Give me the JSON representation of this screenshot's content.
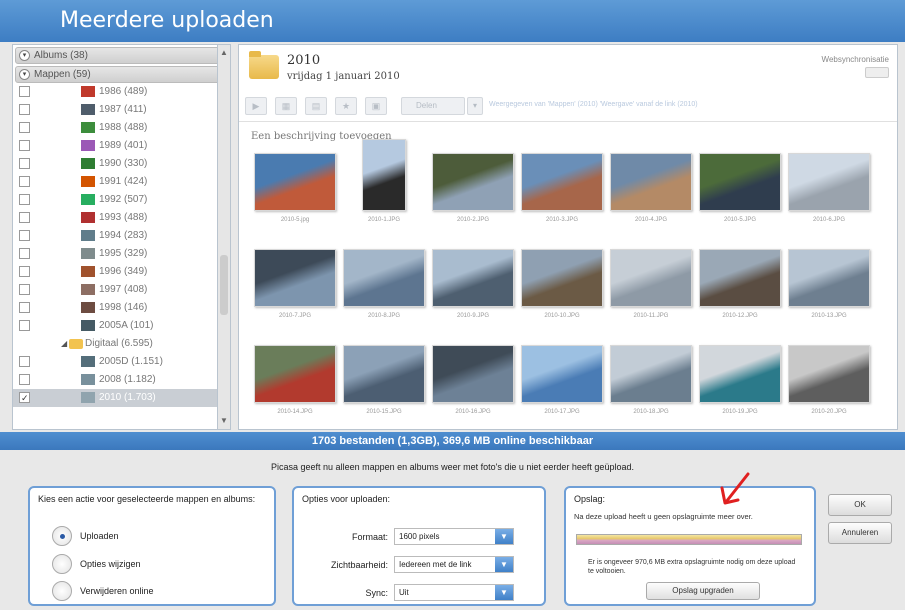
{
  "window": {
    "title": "Meerdere uploaden"
  },
  "sidebar": {
    "albums_header": "Albums (38)",
    "folders_header": "Mappen (59)",
    "items": [
      {
        "label": "1986 (489)",
        "color": "#c0392b"
      },
      {
        "label": "1987 (411)",
        "color": "#4f5d6b"
      },
      {
        "label": "1988 (488)",
        "color": "#3c8d3c"
      },
      {
        "label": "1989 (401)",
        "color": "#9b59b6"
      },
      {
        "label": "1990 (330)",
        "color": "#2e7d32"
      },
      {
        "label": "1991 (424)",
        "color": "#d35400"
      },
      {
        "label": "1992 (507)",
        "color": "#27ae60"
      },
      {
        "label": "1993 (488)",
        "color": "#b03030"
      },
      {
        "label": "1994 (283)",
        "color": "#607d8b"
      },
      {
        "label": "1995 (329)",
        "color": "#7f8c8d"
      },
      {
        "label": "1996 (349)",
        "color": "#a0522d"
      },
      {
        "label": "1997 (408)",
        "color": "#8d6e63"
      },
      {
        "label": "1998 (146)",
        "color": "#6d4c41"
      },
      {
        "label": "2005A (101)",
        "color": "#455a64"
      }
    ],
    "digital_folder": "Digitaal (6.595)",
    "digital_items": [
      {
        "label": "2005D (1.151)",
        "color": "#546e7a"
      },
      {
        "label": "2008 (1.182)",
        "color": "#78909c"
      },
      {
        "label": "2010 (1.703)",
        "color": "#90a4ae"
      }
    ]
  },
  "album": {
    "title": "2010",
    "date": "vrijdag 1 januari 2010",
    "websync_label": "Websynchronisatie",
    "share_label": "Delen",
    "toolbar_info": "Weergegeven van 'Mappen' (2010) 'Weergave' vanaf de link (2010)",
    "description_placeholder": "Een beschrijving toevoegen",
    "photos": [
      {
        "caption": "2010-5.jpg",
        "colors": [
          "#c05a3a",
          "#4a7bb0"
        ]
      },
      {
        "caption": "2010-1.JPG",
        "colors": [
          "#2a2a2a",
          "#b5c9e0"
        ]
      },
      {
        "caption": "2010-2.JPG",
        "colors": [
          "#8fa1b5",
          "#4d5c3a"
        ]
      },
      {
        "caption": "2010-3.JPG",
        "colors": [
          "#a7664a",
          "#6a8fb8"
        ]
      },
      {
        "caption": "2010-4.JPG",
        "colors": [
          "#b48a66",
          "#6f8aa8"
        ]
      },
      {
        "caption": "2010-5.JPG",
        "colors": [
          "#2f3d4e",
          "#4c6b3a"
        ]
      },
      {
        "caption": "2010-6.JPG",
        "colors": [
          "#9aa3ad",
          "#cfd9e4"
        ]
      },
      {
        "caption": "2010-7.JPG",
        "colors": [
          "#7d95ae",
          "#3d4a58"
        ]
      },
      {
        "caption": "2010-8.JPG",
        "colors": [
          "#5d7590",
          "#a3b6c9"
        ]
      },
      {
        "caption": "2010-9.JPG",
        "colors": [
          "#4e5f70",
          "#a9bccf"
        ]
      },
      {
        "caption": "2010-10.JPG",
        "colors": [
          "#6b5a45",
          "#8fa0b2"
        ]
      },
      {
        "caption": "2010-11.JPG",
        "colors": [
          "#8e9aa6",
          "#c6ced6"
        ]
      },
      {
        "caption": "2010-12.JPG",
        "colors": [
          "#5a4d42",
          "#9aa8b6"
        ]
      },
      {
        "caption": "2010-13.JPG",
        "colors": [
          "#6e7f90",
          "#b7c5d3"
        ]
      },
      {
        "caption": "2010-14.JPG",
        "colors": [
          "#b23a2e",
          "#6a7d5a"
        ]
      },
      {
        "caption": "2010-15.JPG",
        "colors": [
          "#4c5e72",
          "#8ca1b7"
        ]
      },
      {
        "caption": "2010-16.JPG",
        "colors": [
          "#6d8196",
          "#3f4b57"
        ]
      },
      {
        "caption": "2010-17.JPG",
        "colors": [
          "#4a7cb5",
          "#9cc0e2"
        ]
      },
      {
        "caption": "2010-18.JPG",
        "colors": [
          "#6b7e8f",
          "#c2ccd6"
        ]
      },
      {
        "caption": "2010-19.JPG",
        "colors": [
          "#2b7a8a",
          "#d2d7dc"
        ]
      },
      {
        "caption": "2010-20.JPG",
        "colors": [
          "#5e5e5e",
          "#c8c8c8"
        ]
      }
    ]
  },
  "status": {
    "text": "1703 bestanden (1,3GB), 369,6 MB online beschikbaar"
  },
  "bottom": {
    "info_line": "Picasa geeft nu alleen mappen en albums weer met foto's die u niet eerder heeft geüpload.",
    "actions": {
      "title": "Kies een actie voor geselecteerde mappen en albums:",
      "upload": "Uploaden",
      "change_options": "Opties wijzigen",
      "remove_online": "Verwijderen online"
    },
    "options": {
      "title": "Opties voor uploaden:",
      "format_label": "Formaat:",
      "format_value": "1600 pixels",
      "visibility_label": "Zichtbaarheid:",
      "visibility_value": "Iedereen met de link",
      "sync_label": "Sync:",
      "sync_value": "Uit"
    },
    "storage": {
      "title": "Opslag:",
      "text": "Na deze upload heeft u geen opslagruimte meer over.",
      "note": "Er is ongeveer 970,6 MB extra opslagruimte nodig om deze upload te voltooien.",
      "upgrade_button": "Opslag upgraden"
    },
    "ok_button": "OK",
    "cancel_button": "Annuleren"
  },
  "colors": {
    "accent": "#3d7dc3",
    "arrow": "#e02020"
  }
}
